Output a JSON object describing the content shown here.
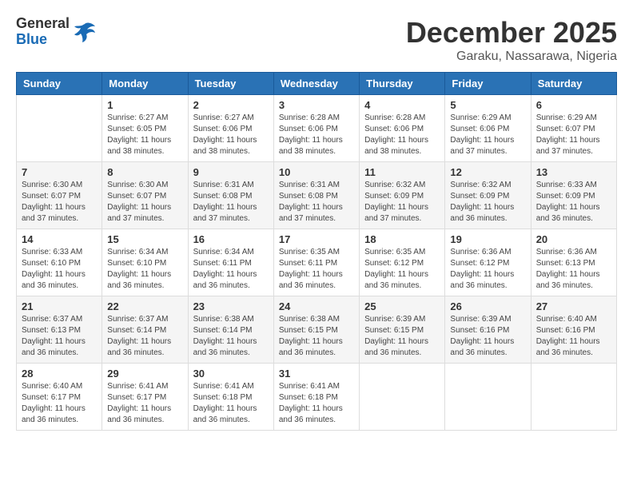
{
  "header": {
    "logo": {
      "line1": "General",
      "line2": "Blue"
    },
    "month": "December 2025",
    "location": "Garaku, Nassarawa, Nigeria"
  },
  "days_of_week": [
    "Sunday",
    "Monday",
    "Tuesday",
    "Wednesday",
    "Thursday",
    "Friday",
    "Saturday"
  ],
  "weeks": [
    [
      {
        "day": "",
        "sunrise": "",
        "sunset": "",
        "daylight": ""
      },
      {
        "day": "1",
        "sunrise": "Sunrise: 6:27 AM",
        "sunset": "Sunset: 6:05 PM",
        "daylight": "Daylight: 11 hours and 38 minutes."
      },
      {
        "day": "2",
        "sunrise": "Sunrise: 6:27 AM",
        "sunset": "Sunset: 6:06 PM",
        "daylight": "Daylight: 11 hours and 38 minutes."
      },
      {
        "day": "3",
        "sunrise": "Sunrise: 6:28 AM",
        "sunset": "Sunset: 6:06 PM",
        "daylight": "Daylight: 11 hours and 38 minutes."
      },
      {
        "day": "4",
        "sunrise": "Sunrise: 6:28 AM",
        "sunset": "Sunset: 6:06 PM",
        "daylight": "Daylight: 11 hours and 38 minutes."
      },
      {
        "day": "5",
        "sunrise": "Sunrise: 6:29 AM",
        "sunset": "Sunset: 6:06 PM",
        "daylight": "Daylight: 11 hours and 37 minutes."
      },
      {
        "day": "6",
        "sunrise": "Sunrise: 6:29 AM",
        "sunset": "Sunset: 6:07 PM",
        "daylight": "Daylight: 11 hours and 37 minutes."
      }
    ],
    [
      {
        "day": "7",
        "sunrise": "Sunrise: 6:30 AM",
        "sunset": "Sunset: 6:07 PM",
        "daylight": "Daylight: 11 hours and 37 minutes."
      },
      {
        "day": "8",
        "sunrise": "Sunrise: 6:30 AM",
        "sunset": "Sunset: 6:07 PM",
        "daylight": "Daylight: 11 hours and 37 minutes."
      },
      {
        "day": "9",
        "sunrise": "Sunrise: 6:31 AM",
        "sunset": "Sunset: 6:08 PM",
        "daylight": "Daylight: 11 hours and 37 minutes."
      },
      {
        "day": "10",
        "sunrise": "Sunrise: 6:31 AM",
        "sunset": "Sunset: 6:08 PM",
        "daylight": "Daylight: 11 hours and 37 minutes."
      },
      {
        "day": "11",
        "sunrise": "Sunrise: 6:32 AM",
        "sunset": "Sunset: 6:09 PM",
        "daylight": "Daylight: 11 hours and 37 minutes."
      },
      {
        "day": "12",
        "sunrise": "Sunrise: 6:32 AM",
        "sunset": "Sunset: 6:09 PM",
        "daylight": "Daylight: 11 hours and 36 minutes."
      },
      {
        "day": "13",
        "sunrise": "Sunrise: 6:33 AM",
        "sunset": "Sunset: 6:09 PM",
        "daylight": "Daylight: 11 hours and 36 minutes."
      }
    ],
    [
      {
        "day": "14",
        "sunrise": "Sunrise: 6:33 AM",
        "sunset": "Sunset: 6:10 PM",
        "daylight": "Daylight: 11 hours and 36 minutes."
      },
      {
        "day": "15",
        "sunrise": "Sunrise: 6:34 AM",
        "sunset": "Sunset: 6:10 PM",
        "daylight": "Daylight: 11 hours and 36 minutes."
      },
      {
        "day": "16",
        "sunrise": "Sunrise: 6:34 AM",
        "sunset": "Sunset: 6:11 PM",
        "daylight": "Daylight: 11 hours and 36 minutes."
      },
      {
        "day": "17",
        "sunrise": "Sunrise: 6:35 AM",
        "sunset": "Sunset: 6:11 PM",
        "daylight": "Daylight: 11 hours and 36 minutes."
      },
      {
        "day": "18",
        "sunrise": "Sunrise: 6:35 AM",
        "sunset": "Sunset: 6:12 PM",
        "daylight": "Daylight: 11 hours and 36 minutes."
      },
      {
        "day": "19",
        "sunrise": "Sunrise: 6:36 AM",
        "sunset": "Sunset: 6:12 PM",
        "daylight": "Daylight: 11 hours and 36 minutes."
      },
      {
        "day": "20",
        "sunrise": "Sunrise: 6:36 AM",
        "sunset": "Sunset: 6:13 PM",
        "daylight": "Daylight: 11 hours and 36 minutes."
      }
    ],
    [
      {
        "day": "21",
        "sunrise": "Sunrise: 6:37 AM",
        "sunset": "Sunset: 6:13 PM",
        "daylight": "Daylight: 11 hours and 36 minutes."
      },
      {
        "day": "22",
        "sunrise": "Sunrise: 6:37 AM",
        "sunset": "Sunset: 6:14 PM",
        "daylight": "Daylight: 11 hours and 36 minutes."
      },
      {
        "day": "23",
        "sunrise": "Sunrise: 6:38 AM",
        "sunset": "Sunset: 6:14 PM",
        "daylight": "Daylight: 11 hours and 36 minutes."
      },
      {
        "day": "24",
        "sunrise": "Sunrise: 6:38 AM",
        "sunset": "Sunset: 6:15 PM",
        "daylight": "Daylight: 11 hours and 36 minutes."
      },
      {
        "day": "25",
        "sunrise": "Sunrise: 6:39 AM",
        "sunset": "Sunset: 6:15 PM",
        "daylight": "Daylight: 11 hours and 36 minutes."
      },
      {
        "day": "26",
        "sunrise": "Sunrise: 6:39 AM",
        "sunset": "Sunset: 6:16 PM",
        "daylight": "Daylight: 11 hours and 36 minutes."
      },
      {
        "day": "27",
        "sunrise": "Sunrise: 6:40 AM",
        "sunset": "Sunset: 6:16 PM",
        "daylight": "Daylight: 11 hours and 36 minutes."
      }
    ],
    [
      {
        "day": "28",
        "sunrise": "Sunrise: 6:40 AM",
        "sunset": "Sunset: 6:17 PM",
        "daylight": "Daylight: 11 hours and 36 minutes."
      },
      {
        "day": "29",
        "sunrise": "Sunrise: 6:41 AM",
        "sunset": "Sunset: 6:17 PM",
        "daylight": "Daylight: 11 hours and 36 minutes."
      },
      {
        "day": "30",
        "sunrise": "Sunrise: 6:41 AM",
        "sunset": "Sunset: 6:18 PM",
        "daylight": "Daylight: 11 hours and 36 minutes."
      },
      {
        "day": "31",
        "sunrise": "Sunrise: 6:41 AM",
        "sunset": "Sunset: 6:18 PM",
        "daylight": "Daylight: 11 hours and 36 minutes."
      },
      {
        "day": "",
        "sunrise": "",
        "sunset": "",
        "daylight": ""
      },
      {
        "day": "",
        "sunrise": "",
        "sunset": "",
        "daylight": ""
      },
      {
        "day": "",
        "sunrise": "",
        "sunset": "",
        "daylight": ""
      }
    ]
  ]
}
